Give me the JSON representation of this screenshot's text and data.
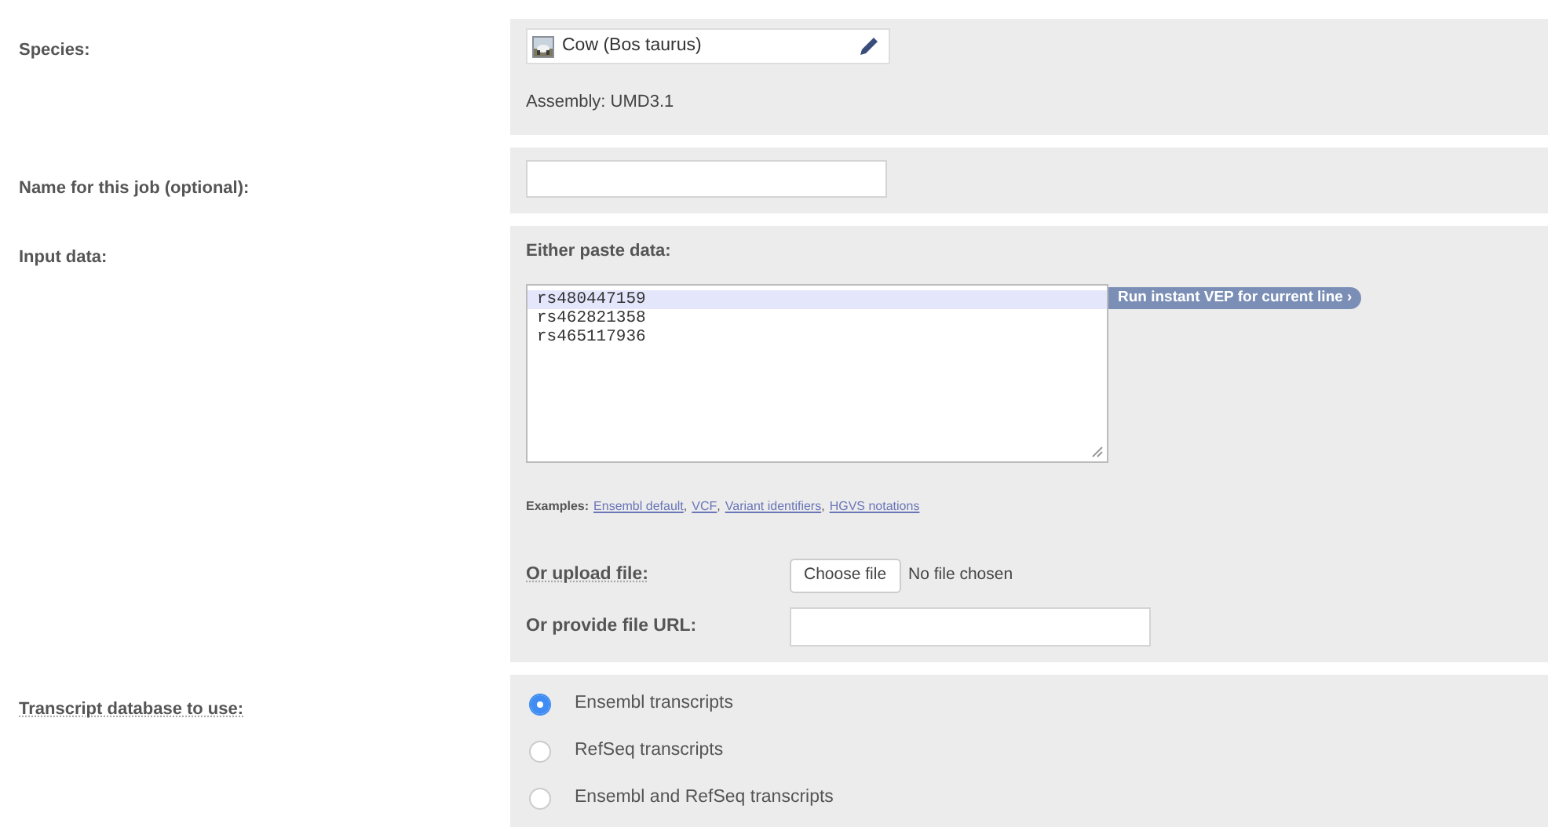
{
  "rows": [
    {
      "kind": "species",
      "label": "Species:",
      "species": "Cow (Bos taurus)",
      "assembly": "Assembly: UMD3.1"
    },
    {
      "kind": "text",
      "label": "Name for this job (optional):"
    },
    {
      "kind": "input",
      "label": "Input data:",
      "paste_heading": "Either paste data:",
      "lines": [
        {
          "text": "rs480447159",
          "selected": true
        },
        {
          "text": "rs462821358",
          "selected": false
        },
        {
          "text": "rs465117936",
          "selected": false
        }
      ],
      "run_button": "Run instant VEP for current line ›",
      "examples_label": "Examples:",
      "examples_separator": ",",
      "examples": [
        "Ensembl default",
        "VCF",
        "Variant identifiers",
        "HGVS notations"
      ],
      "upload_label": "Or upload file:",
      "choose_button": "Choose file",
      "no_file": "No file chosen",
      "url_label": "Or provide file URL:"
    },
    {
      "kind": "radio",
      "label": "Transcript database to use:",
      "options": [
        {
          "label": "Ensembl transcripts",
          "selected": true
        },
        {
          "label": "RefSeq transcripts",
          "selected": false
        },
        {
          "label": "Ensembl and RefSeq transcripts",
          "selected": false
        }
      ]
    }
  ]
}
